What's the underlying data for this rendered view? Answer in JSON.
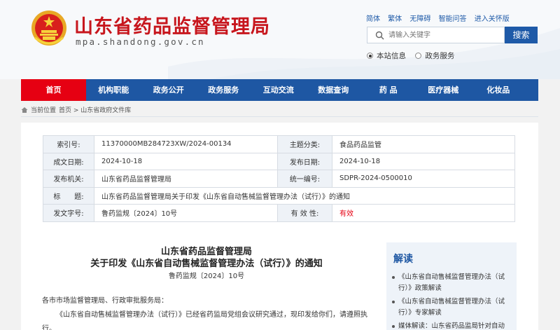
{
  "header": {
    "title": "山东省药品监督管理局",
    "domain": "mpa.shandong.gov.cn",
    "top_links": [
      "简体",
      "繁体",
      "无障碍",
      "智能问答",
      "进入关怀版"
    ],
    "search": {
      "placeholder": "请输入关键字",
      "button": "搜索"
    },
    "scope_options": [
      {
        "label": "本站信息",
        "selected": true
      },
      {
        "label": "政务服务",
        "selected": false
      }
    ]
  },
  "nav": {
    "items": [
      "首页",
      "机构职能",
      "政务公开",
      "政务服务",
      "互动交流",
      "数据查询",
      "药 品",
      "医疗器械",
      "化妆品"
    ]
  },
  "breadcrumb": {
    "prefix": "当前位置",
    "path": "首页 > 山东省政府文件库"
  },
  "info": {
    "index_no_label": "索引号:",
    "index_no": "11370000MB284723XW/2024-00134",
    "subject_label": "主题分类:",
    "subject": "食品药品监管",
    "created_label": "成文日期:",
    "created": "2024-10-18",
    "published_label": "发布日期:",
    "published": "2024-10-18",
    "issuer_label": "发布机关:",
    "issuer": "山东省药品监督管理局",
    "unified_no_label": "统一编号:",
    "unified_no": "SDPR-2024-0500010",
    "title_label": "标　　题:",
    "title": "山东省药品监督管理局关于印发《山东省自动售械监督管理办法（试行）》的通知",
    "doc_no_label": "发文字号:",
    "doc_no": "鲁药监规〔2024〕10号",
    "validity_label": "有 效 性:",
    "validity": "有效"
  },
  "document": {
    "org": "山东省药品监督管理局",
    "title": "关于印发《山东省自动售械监督管理办法（试行）》的通知",
    "number": "鲁药监规〔2024〕10号",
    "salutation": "各市市场监督管理局、行政审批服务局：",
    "para1": "《山东省自动售械监督管理办法（试行）》已经省药监局党组会议研究通过，现印发给你们，请遵照执行。"
  },
  "sidebar": {
    "title": "解读",
    "items": [
      "《山东省自动售械监督管理办法（试行）》政策解读",
      "《山东省自动售械监督管理办法（试行）》专家解读",
      "媒体解读：山东省药品监局针对自动"
    ]
  },
  "colors": {
    "brand_red": "#c7161d",
    "nav_blue": "#1e57a3",
    "active_red": "#e60012"
  }
}
